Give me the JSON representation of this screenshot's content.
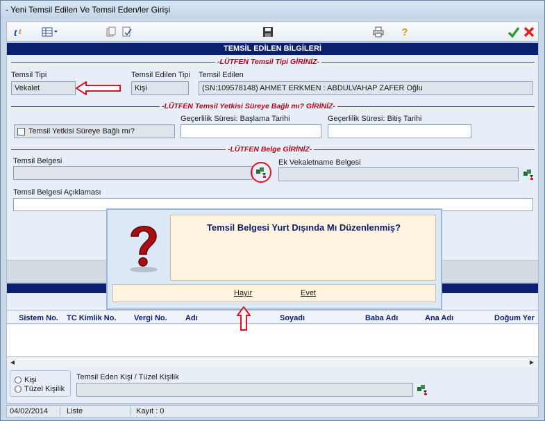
{
  "window": {
    "title": "- Yeni Temsil Edilen Ve Temsil Eden/ler Girişi"
  },
  "toolbar": {
    "icons": [
      "app-logo-icon",
      "table-menu-icon",
      "copy-icon",
      "check-doc-icon",
      "save-icon",
      "print-icon",
      "help-icon",
      "confirm-icon",
      "cancel-icon"
    ]
  },
  "section": {
    "title": "TEMSİL EDİLEN BİLGİLERİ"
  },
  "dividers": {
    "temsil_tipi": "LÜTFEN Temsil Tipi GİRİNİZ",
    "sureye_bagli": "LÜTFEN Temsil Yetkisi Süreye Bağlı mı? GİRİNİZ",
    "belge": "LÜTFEN Belge GİRİNİZ"
  },
  "form": {
    "temsil_tipi_label": "Temsil Tipi",
    "temsil_tipi_value": "Vekalet",
    "temsil_edilen_tipi_label": "Temsil Edilen Tipi",
    "temsil_edilen_tipi_value": "Kişi",
    "temsil_edilen_label": "Temsil Edilen",
    "temsil_edilen_value": "(SN:109578148) AHMET ERKMEN : ABDULVAHAP ZAFER Oğlu",
    "sureye_bagli_label": "Temsil Yetkisi Süreye Bağlı mı?",
    "baslama_label": "Geçerlilik Süresi: Başlama Tarihi",
    "bitis_label": "Geçerlilik Süresi: Bitiş Tarihi",
    "temsil_belgesi_label": "Temsil Belgesi",
    "ek_vekaletname_label": "Ek Vekaletname Belgesi",
    "aciklama_label": "Temsil Belgesi Açıklaması"
  },
  "grid": {
    "columns": [
      "Sistem No.",
      "TC Kimlik No.",
      "Vergi No.",
      "Adı",
      "Soyadı",
      "Baba Adı",
      "Ana Adı",
      "Doğum Yer"
    ]
  },
  "temsil_eden": {
    "kisi_label": "Kişi",
    "tuzel_label": "Tüzel Kişilik",
    "field_label": "Temsil Eden Kişi / Tüzel Kişilik"
  },
  "status": {
    "date": "04/02/2014",
    "mode": "Liste",
    "records": "Kayıt : 0"
  },
  "dialog": {
    "message": "Temsil Belgesi Yurt Dışında Mı Düzenlenmiş?",
    "no_label": "Hayır",
    "yes_label": "Evet"
  },
  "colors": {
    "header_navy": "#0a1f6e",
    "accent_red": "#c0001c",
    "dialog_bg": "#fdf3de"
  }
}
